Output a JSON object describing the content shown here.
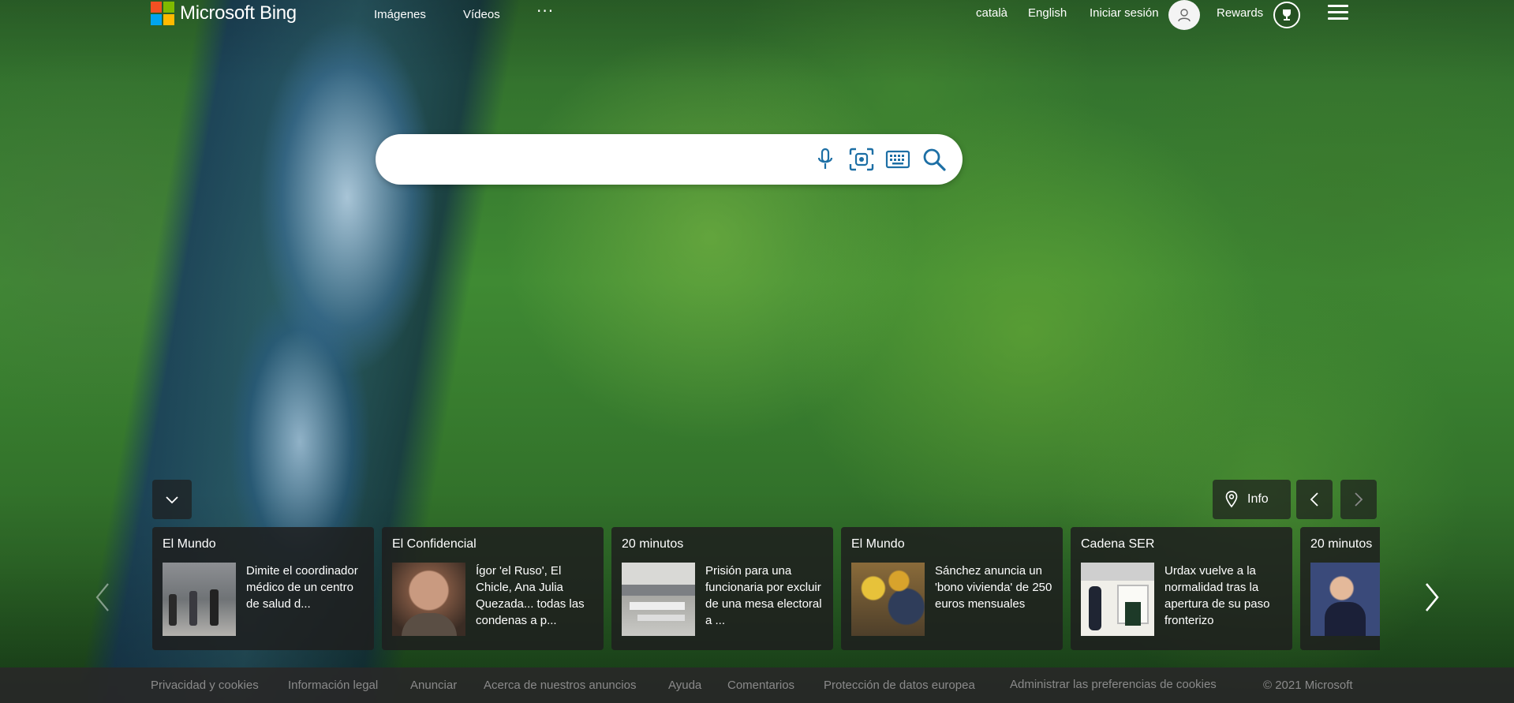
{
  "brand": {
    "name": "Microsoft Bing",
    "colors": [
      "#f25022",
      "#7fba00",
      "#00a4ef",
      "#ffb900"
    ]
  },
  "nav": {
    "images": "Imágenes",
    "videos": "Vídeos",
    "more": "···"
  },
  "header_right": {
    "lang_catalan": "català",
    "lang_english": "English",
    "sign_in": "Iniciar sesión",
    "rewards": "Rewards"
  },
  "search": {
    "placeholder": "",
    "value": "",
    "tools": [
      "microphone-icon",
      "visual-search-icon",
      "keyboard-icon",
      "search-icon"
    ]
  },
  "controls": {
    "info": "Info"
  },
  "news": [
    {
      "source": "El Mundo",
      "title": "Dimite el coordinador médico de un centro de salud d..."
    },
    {
      "source": "El Confidencial",
      "title": "Ígor 'el Ruso', El Chicle, Ana Julia Quezada... todas las condenas a p..."
    },
    {
      "source": "20 minutos",
      "title": "Prisión para una funcionaria por excluir de una mesa electoral a ..."
    },
    {
      "source": "El Mundo",
      "title": "Sánchez anuncia un 'bono vivienda' de 250 euros mensuales"
    },
    {
      "source": "Cadena SER",
      "title": "Urdax vuelve a la normalidad tras la apertura de su paso fronterizo"
    },
    {
      "source": "20 minutos",
      "title": ""
    }
  ],
  "footer": {
    "links": [
      "Privacidad y cookies",
      "Información legal",
      "Anunciar",
      "Acerca de nuestros anuncios",
      "Ayuda",
      "Comentarios",
      "Protección de datos europea",
      "Administrar las preferencias de cookies"
    ],
    "copyright": "© 2021 Microsoft"
  }
}
